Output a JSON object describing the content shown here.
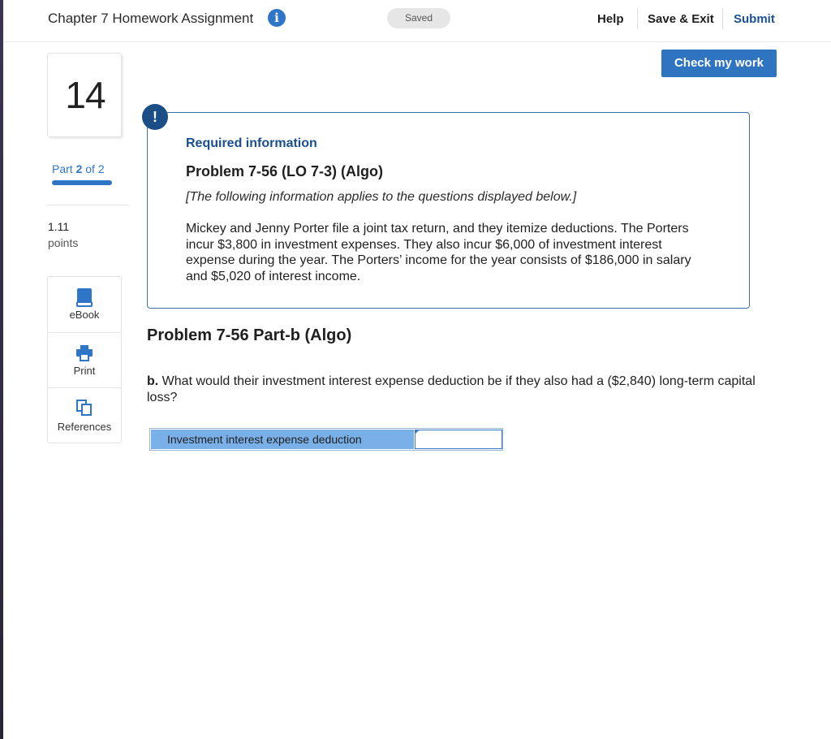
{
  "header": {
    "assignment_title": "Chapter 7 Homework Assignment",
    "status": "Saved",
    "help": "Help",
    "save_exit": "Save & Exit",
    "submit": "Submit"
  },
  "check_button": "Check my work",
  "sidebar": {
    "question_number": "14",
    "part_word": "Part",
    "part_current": "2",
    "part_of": "of 2",
    "part_progress": 1.0,
    "points_value": "1.11",
    "points_label": "points",
    "tools": [
      {
        "label": "eBook",
        "icon": "book-icon"
      },
      {
        "label": "Print",
        "icon": "printer-icon"
      },
      {
        "label": "References",
        "icon": "copy-icon"
      }
    ]
  },
  "info_box": {
    "required": "Required information",
    "problem_title": "Problem 7-56 (LO 7-3) (Algo)",
    "note": "[The following information applies to the questions displayed below.]",
    "body": "Mickey and Jenny Porter file a joint tax return, and they itemize deductions. The Porters incur $3,800 in investment expenses. They also incur $6,000 of investment interest expense during the year. The Porters’ income for the year consists of $186,000 in salary and $5,020 of interest income."
  },
  "part_heading": "Problem 7-56 Part-b (Algo)",
  "question": {
    "prefix": "b.",
    "text": "What would their investment interest expense deduction be if they also had a ($2,840) long-term capital loss?"
  },
  "answer": {
    "label": "Investment interest expense deduction",
    "value": ""
  },
  "colors": {
    "accent": "#2f76c9",
    "dark_blue": "#1a4f8f",
    "answer_label_bg": "#7ab0e8"
  }
}
